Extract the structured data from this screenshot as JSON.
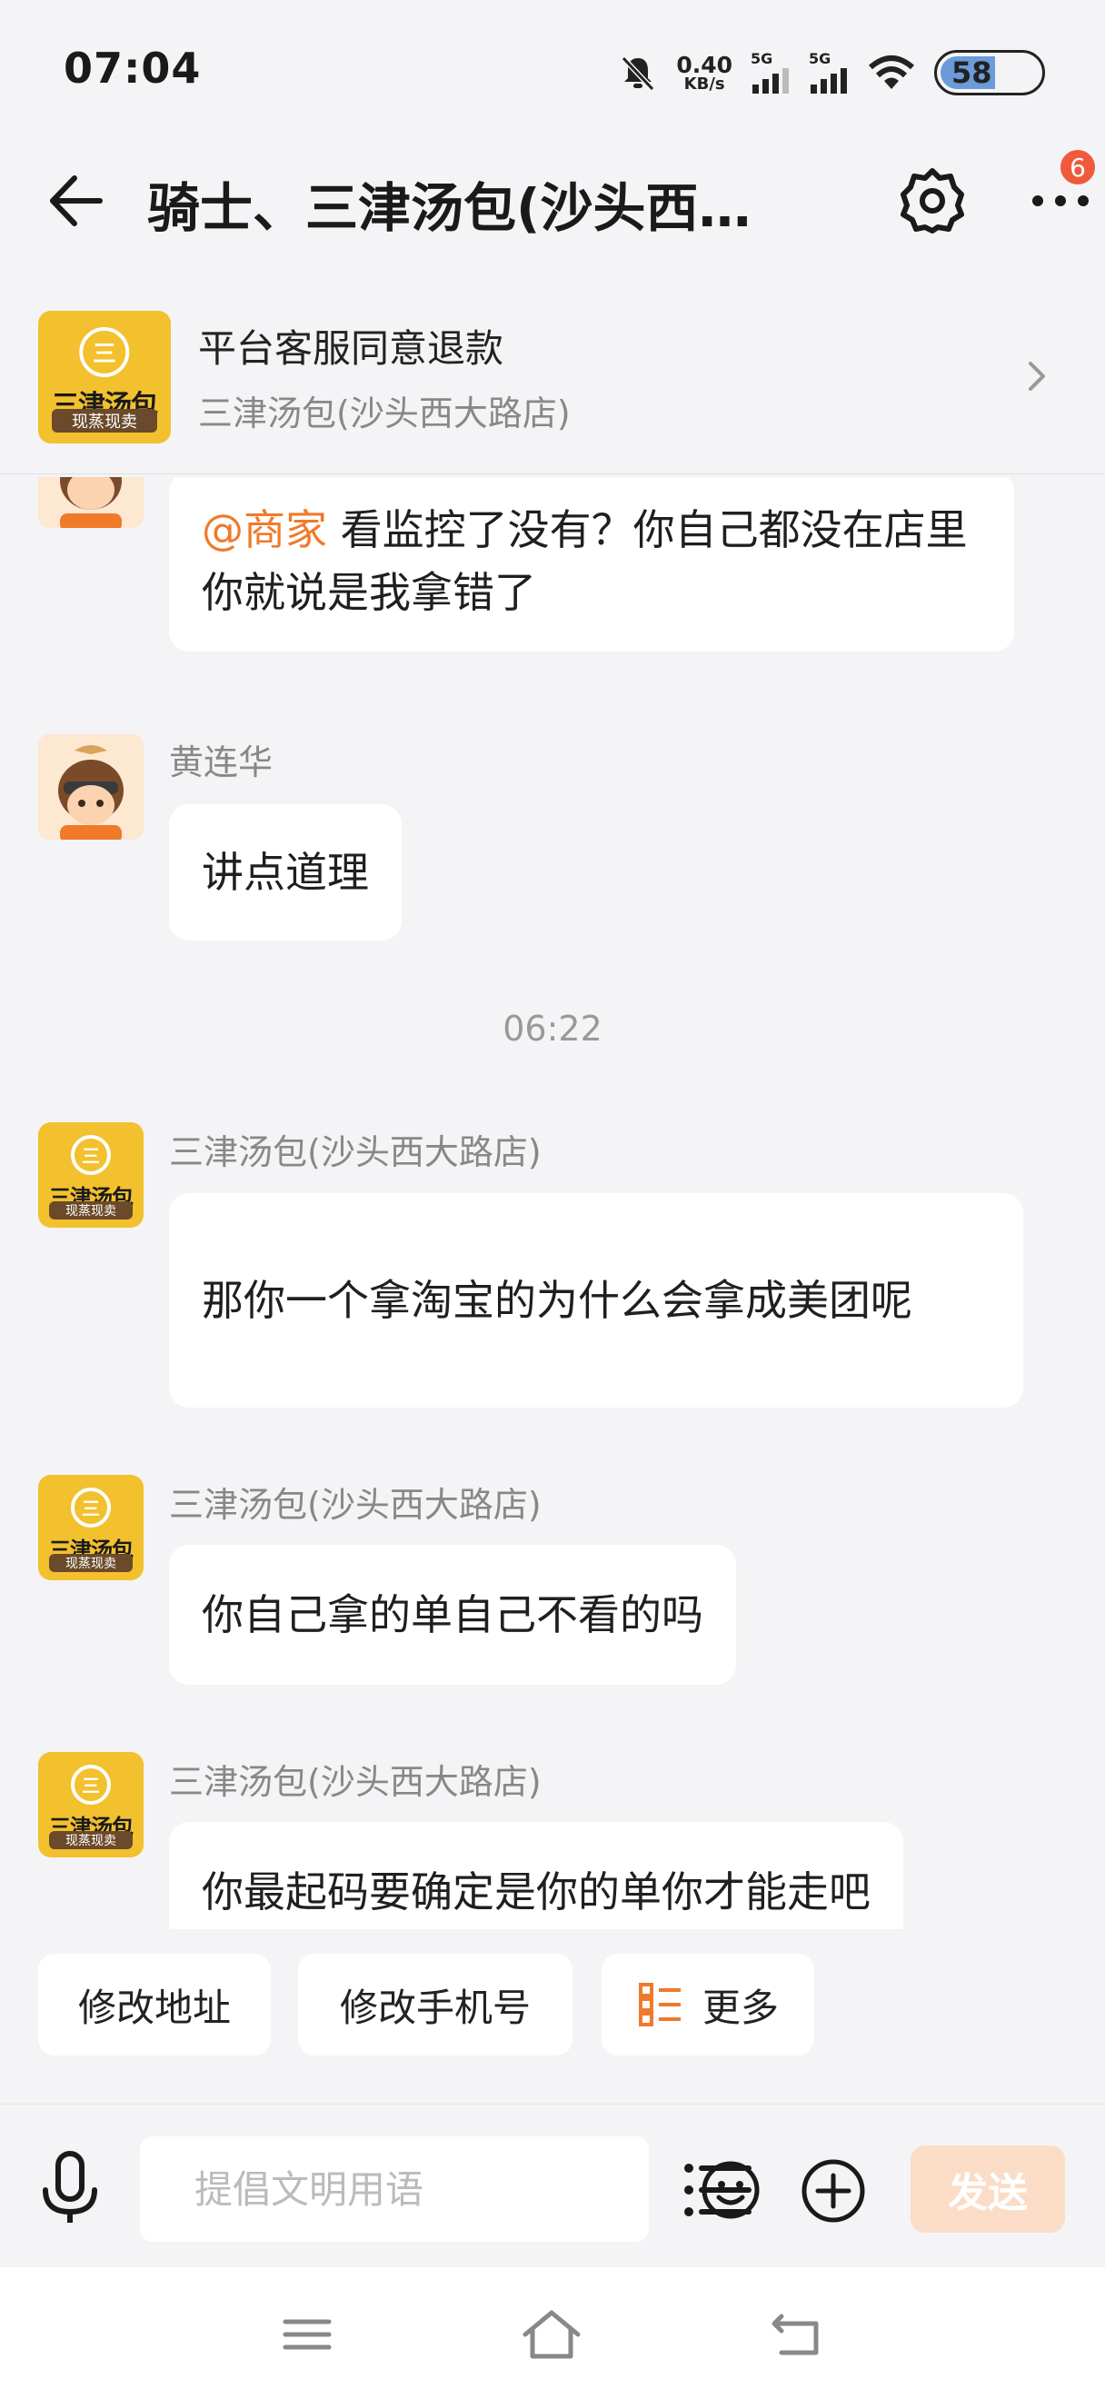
{
  "status_bar": {
    "time": "07:04",
    "net_speed": "0.40",
    "net_unit": "KB/s",
    "sig1": "5G",
    "sig2": "5G",
    "battery": "58"
  },
  "header": {
    "title": "骑士、三津汤包(沙头西…",
    "badge": "6"
  },
  "order_card": {
    "title": "平台客服同意退款",
    "store": "三津汤包(沙头西大路店)"
  },
  "logo": {
    "symbol": "三",
    "name": "三津汤包",
    "tag": "现蒸现卖"
  },
  "messages": [
    {
      "mention": "@商家",
      "text": " 看监控了没有？你自己都没在店里你就说是我拿错了"
    },
    {
      "sender": "黄连华",
      "text": "讲点道理"
    },
    {
      "timestamp": "06:22"
    },
    {
      "sender": "三津汤包(沙头西大路店)",
      "text": "那你一个拿淘宝的为什么会拿成美团呢"
    },
    {
      "sender": "三津汤包(沙头西大路店)",
      "text": "你自己拿的单自己不看的吗"
    },
    {
      "sender": "三津汤包(沙头西大路店)",
      "text": "你最起码要确定是你的单你才能走吧"
    }
  ],
  "quick_replies": [
    "修改地址",
    "修改手机号",
    "更多"
  ],
  "input": {
    "placeholder": "提倡文明用语",
    "send_label": "发送"
  },
  "colors": {
    "accent": "#f07a2a",
    "brand_yellow": "#f3c02e",
    "send_disabled": "#fbdcc6",
    "badge": "#f05a3a"
  }
}
